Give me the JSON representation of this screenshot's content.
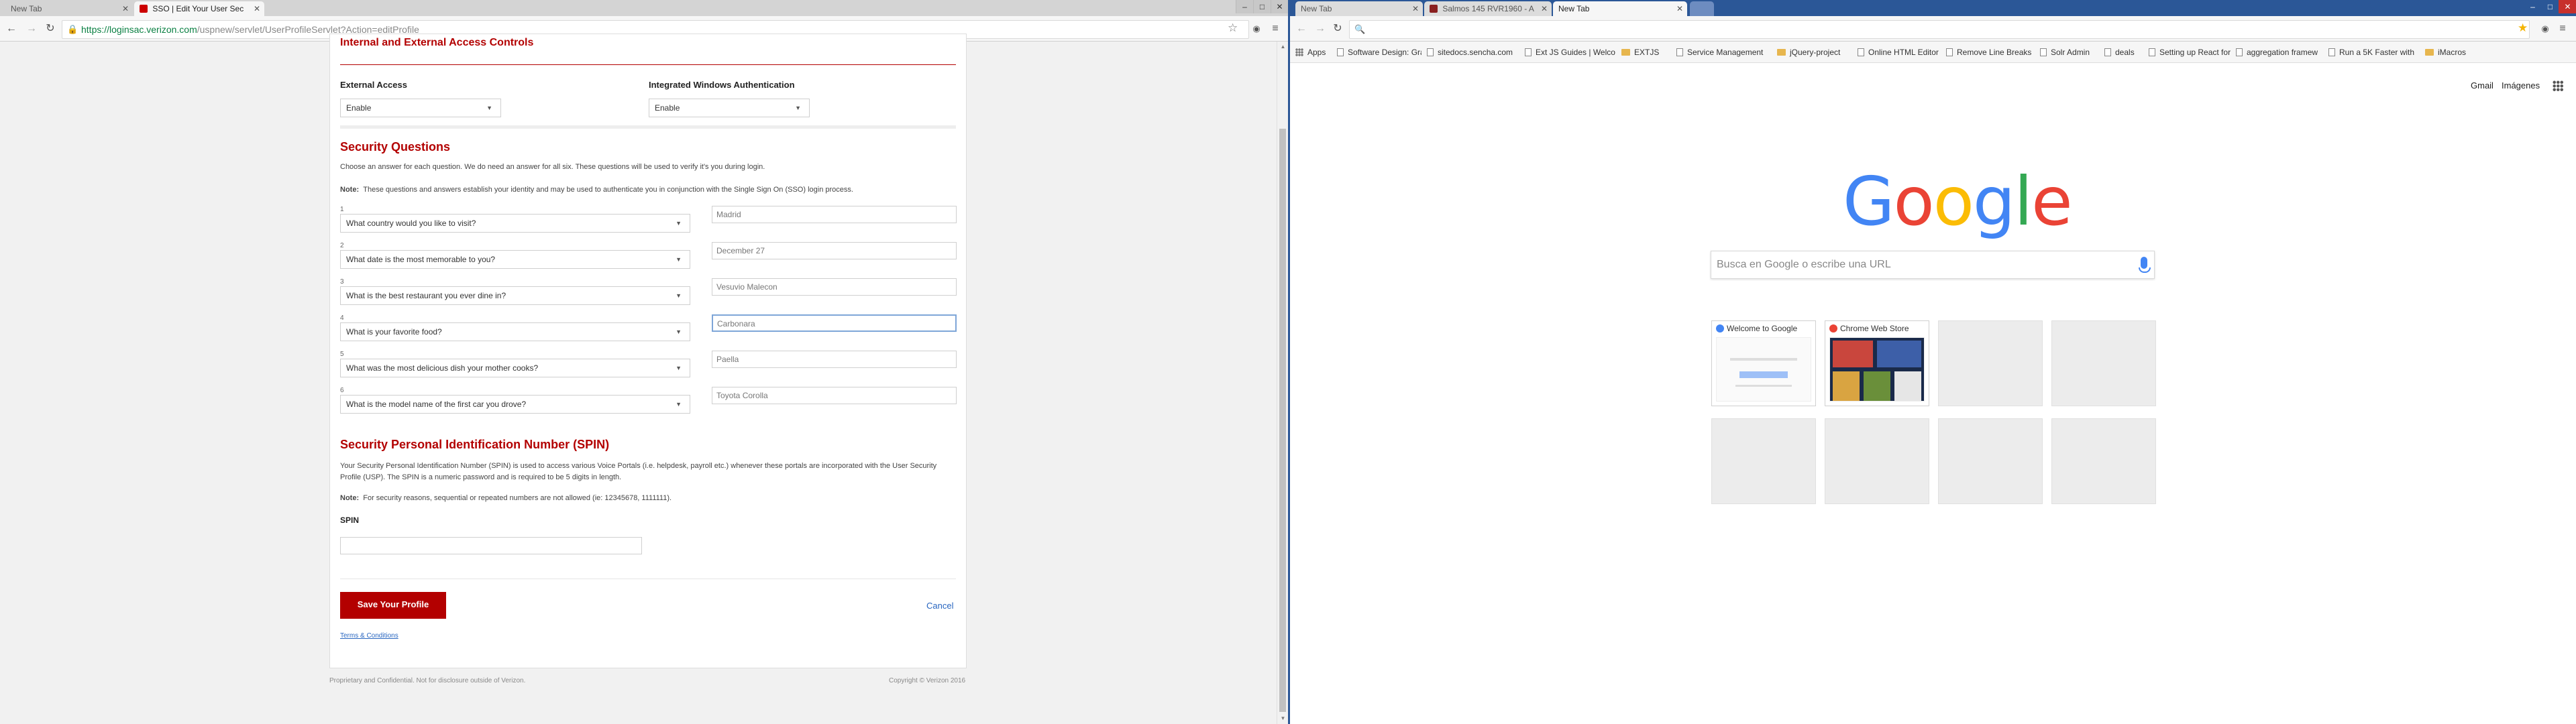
{
  "left_window": {
    "tabs": [
      {
        "title": "New Tab",
        "active": false
      },
      {
        "title": "SSO | Edit Your User Sec",
        "active": true
      },
      {
        "title": "",
        "active": false
      }
    ],
    "url_host": "https://loginsac.verizon.com",
    "url_path": "/uspnew/servlet/UserProfileServlet?Action=editProfile",
    "access": {
      "section_title": "Internal and External Access Controls",
      "external_label": "External Access",
      "external_value": "Enable",
      "iwa_label": "Integrated Windows Authentication",
      "iwa_value": "Enable"
    },
    "security": {
      "title": "Security Questions",
      "intro": "Choose an answer for each question. We do need an answer for all six. These questions will be used to verify it's you during login.",
      "note_label": "Note:",
      "note": "These questions and answers establish your identity and may be used to authenticate you in conjunction with the Single Sign On (SSO) login process.",
      "questions": [
        {
          "num": "1",
          "q": "What country would you like to visit?",
          "a": "Madrid"
        },
        {
          "num": "2",
          "q": "What date is the most memorable to you?",
          "a": "December 27"
        },
        {
          "num": "3",
          "q": "What is the best restaurant you ever dine in?",
          "a": "Vesuvio Malecon"
        },
        {
          "num": "4",
          "q": "What is your favorite food?",
          "a": "Carbonara"
        },
        {
          "num": "5",
          "q": "What was the most delicious dish your mother cooks?",
          "a": "Paella"
        },
        {
          "num": "6",
          "q": "What is the model name of the first car you drove?",
          "a": "Toyota Corolla"
        }
      ]
    },
    "spin": {
      "title": "Security Personal Identification Number (SPIN)",
      "desc": "Your Security Personal Identification Number (SPIN) is used to access various Voice Portals (i.e. helpdesk, payroll etc.) whenever these portals are incorporated with the User Security Profile (USP). The SPIN is a numeric password and is required to be 5 digits in length.",
      "note_label": "Note:",
      "note": "For security reasons, sequential or repeated numbers are not allowed (ie: 12345678, 1111111).",
      "field_label": "SPIN",
      "value": ""
    },
    "actions": {
      "save": "Save Your Profile",
      "cancel": "Cancel",
      "terms": "Terms & Conditions"
    },
    "footer": {
      "left": "Proprietary and Confidential. Not for disclosure outside of Verizon.",
      "right": "Copyright © Verizon 2016"
    }
  },
  "right_window": {
    "tabs": [
      {
        "title": "New Tab",
        "active": false
      },
      {
        "title": "Salmos 145 RVR1960 - A",
        "active": false
      },
      {
        "title": "New Tab",
        "active": true
      }
    ],
    "bookmarks": [
      "Apps",
      "Software Design: Gra",
      "sitedocs.sencha.com",
      "Ext JS Guides | Welco",
      "EXTJS",
      "Service Management",
      "jQuery-project",
      "Online HTML Editor",
      "Remove Line Breaks",
      "Solr Admin",
      "deals",
      "Setting up React for",
      "aggregation framew",
      "Run a 5K Faster with",
      "iMacros"
    ],
    "top_links": {
      "gmail": "Gmail",
      "images": "Imágenes"
    },
    "logo_letters": [
      "G",
      "o",
      "o",
      "g",
      "l",
      "e"
    ],
    "logo_colors": [
      "#4285f4",
      "#ea4335",
      "#fbbc05",
      "#4285f4",
      "#34a853",
      "#ea4335"
    ],
    "search_placeholder": "Busca en Google o escribe una URL",
    "tiles": [
      {
        "title": "Welcome to Google",
        "favicon_color": "#4285f4"
      },
      {
        "title": "Chrome Web Store",
        "favicon_color": "#ea4335"
      }
    ]
  }
}
